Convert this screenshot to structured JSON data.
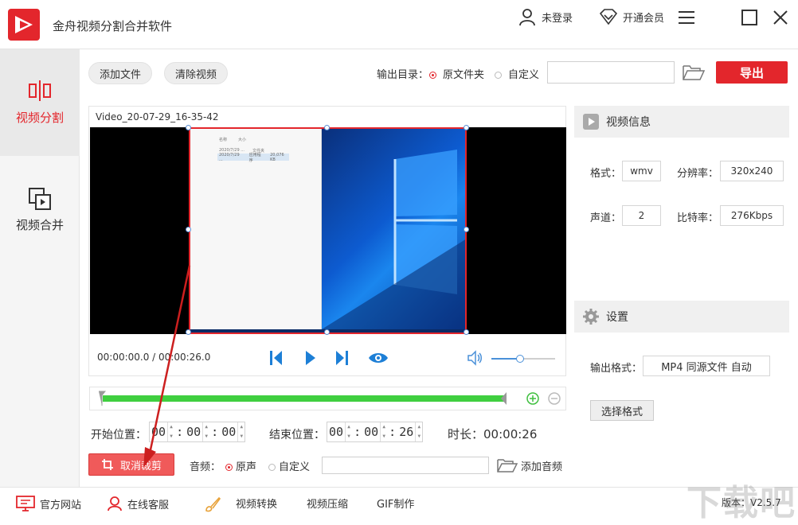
{
  "app": {
    "title": "金舟视频分割合并软件"
  },
  "titlebar": {
    "login_label": "未登录",
    "vip_label": "开通会员"
  },
  "sidebar": {
    "items": [
      {
        "label": "视频分割",
        "active": true
      },
      {
        "label": "视频合并",
        "active": false
      }
    ]
  },
  "toolbar": {
    "add_file_label": "添加文件",
    "clear_video_label": "清除视频",
    "output_dir_label": "输出目录：",
    "output_options": [
      "原文件夹",
      "自定义"
    ],
    "output_selected": "原文件夹",
    "output_path_value": "",
    "export_label": "导出"
  },
  "player": {
    "video_name": "Video_20-07-29_16-35-42",
    "current_time": "00:00:00.0",
    "separator": " / ",
    "total_time": "00:00:26.0",
    "volume_level": 0.45
  },
  "thumbnail_text": {
    "row1": [
      "名称",
      "大小"
    ],
    "row2": [
      "2020/7/29 ...",
      "文件夹"
    ],
    "row3": [
      "2020/7/29 ...",
      "应用程序",
      "20,076 KB"
    ]
  },
  "video_info": {
    "header": "视频信息",
    "format_label": "格式：",
    "format_value": "wmv",
    "resolution_label": "分辨率：",
    "resolution_value": "320x240",
    "channel_label": "声道：",
    "channel_value": "2",
    "bitrate_label": "比特率：",
    "bitrate_value": "276Kbps"
  },
  "settings": {
    "header": "设置",
    "output_format_label": "输出格式：",
    "output_format_value": "MP4 同源文件 自动",
    "select_format_label": "选择格式"
  },
  "timeline": {
    "selection_start": 0.0,
    "selection_end": 1.0
  },
  "trim": {
    "start_label": "开始位置：",
    "start": {
      "h": "00",
      "m": "00",
      "s": "00"
    },
    "end_label": "结束位置：",
    "end": {
      "h": "00",
      "m": "00",
      "s": "26"
    },
    "duration_label": "时长：",
    "duration_value": "00:00:26",
    "colon": ":"
  },
  "audio": {
    "cancel_crop_label": "取消裁剪",
    "audio_label": "音频：",
    "options": [
      "原声",
      "自定义"
    ],
    "selected": "原声",
    "custom_path_value": "",
    "add_audio_label": "添加音频"
  },
  "bottombar": {
    "website_label": "官方网站",
    "service_label": "在线客服",
    "convert_label": "视频转换",
    "compress_label": "视频压缩",
    "gif_label": "GIF制作",
    "version_label": "版本：V2.5.7"
  },
  "watermark": {
    "text": "下载吧"
  },
  "colors": {
    "brand_red": "#e3262c",
    "timeline_green": "#3fcf3f",
    "accent_blue": "#1d7fd6"
  },
  "icons": [
    "app-logo-icon",
    "user-icon",
    "vip-diamond-icon",
    "menu-icon",
    "maximize-icon",
    "close-icon",
    "split-icon",
    "merge-icon",
    "folder-open-icon",
    "video-info-icon",
    "settings-gear-icon",
    "prev-frame-icon",
    "play-icon",
    "next-frame-icon",
    "preview-eye-icon",
    "volume-icon",
    "zoom-in-icon",
    "zoom-out-icon",
    "crop-icon",
    "monitor-icon",
    "headset-icon",
    "brush-icon"
  ]
}
